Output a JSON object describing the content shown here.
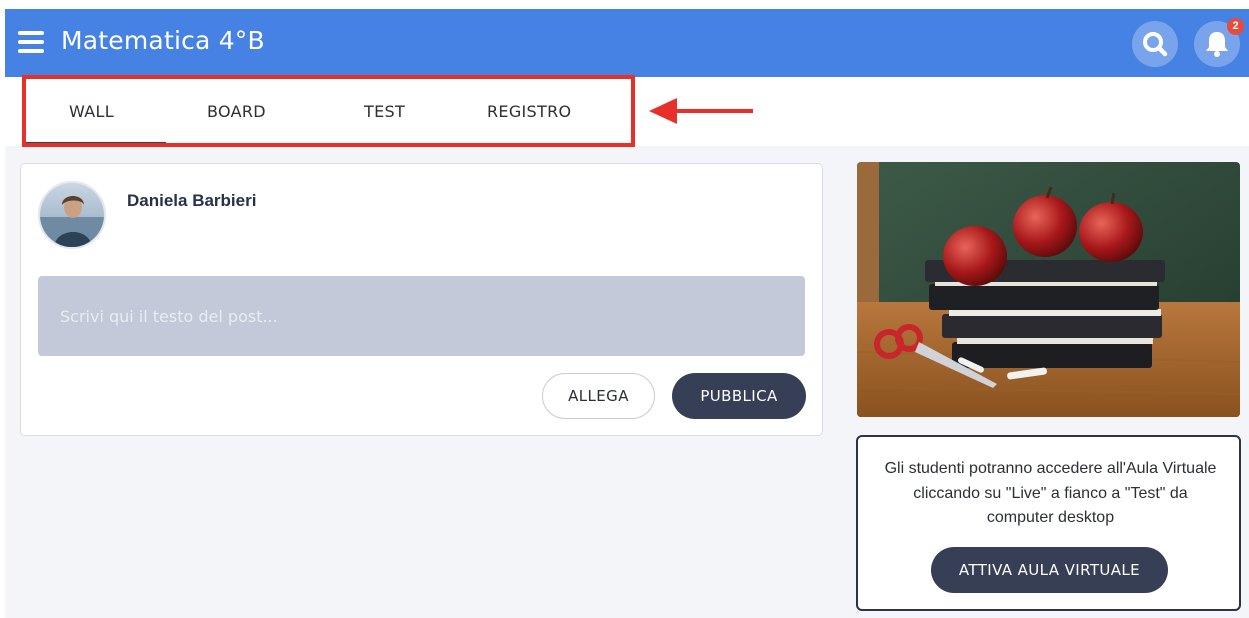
{
  "header": {
    "title": "Matematica 4°B",
    "notification_count": "2",
    "bar_color": "#4682e3"
  },
  "tabs": [
    {
      "label": "WALL",
      "active": true
    },
    {
      "label": "BOARD",
      "active": false
    },
    {
      "label": "TEST",
      "active": false
    },
    {
      "label": "REGISTRO",
      "active": false
    }
  ],
  "annotation": {
    "highlight_color": "#e8302a",
    "arrow_direction": "left"
  },
  "post": {
    "author": "Daniela Barbieri",
    "placeholder": "Scrivi qui il testo del post...",
    "attach_label": "ALLEGA",
    "publish_label": "PUBBLICA"
  },
  "sidebar": {
    "info_text": "Gli studenti potranno accedere all'Aula Virtuale cliccando su \"Live\" a fianco a \"Test\" da computer desktop",
    "activate_label": "ATTIVA AULA VIRTUALE"
  },
  "icons": {
    "menu": "hamburger-menu-icon",
    "search": "search-icon",
    "notifications": "bell-icon"
  }
}
